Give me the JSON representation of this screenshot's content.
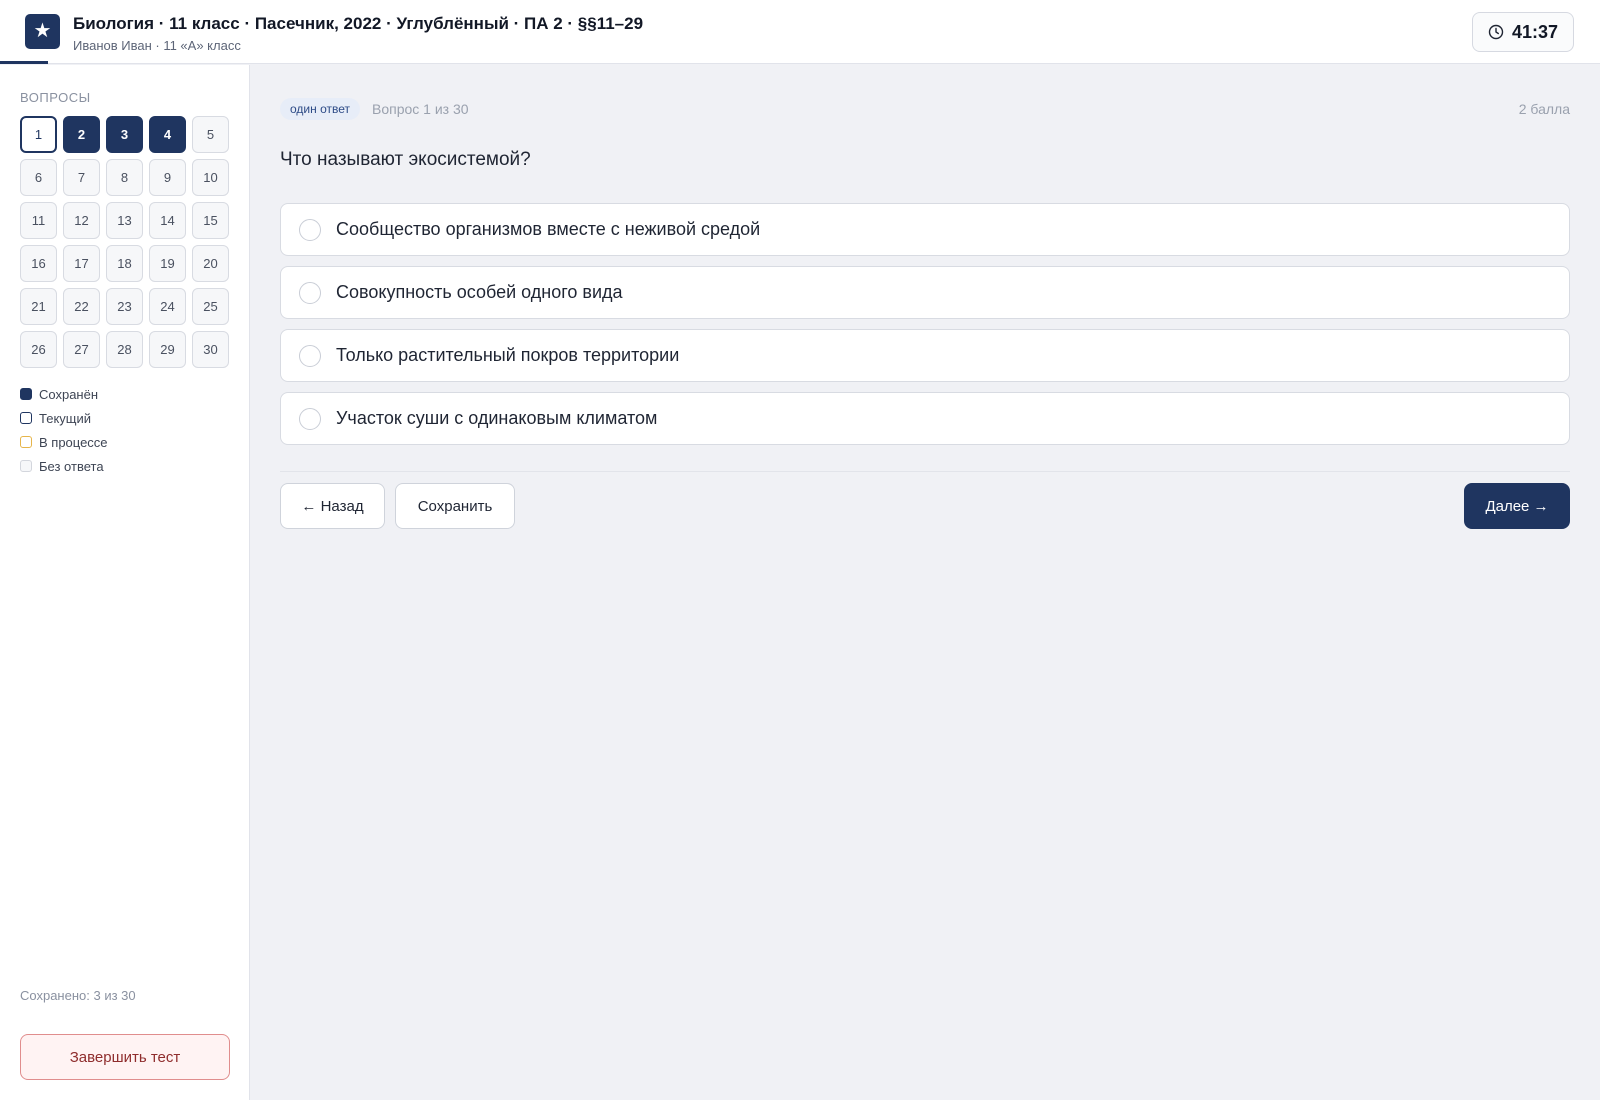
{
  "header": {
    "logo_glyph": "★",
    "title": "Биология · 11 класс · Пасечник, 2022 · Углублённый · ПА 2 · §§11–29",
    "subtitle": "Иванов Иван · 11 «А» класс",
    "timer": "41:37",
    "timer_icon": "clock-icon"
  },
  "sidebar": {
    "title": "ВОПРОСЫ",
    "questions": [
      {
        "n": "1",
        "state": "current"
      },
      {
        "n": "2",
        "state": "saved"
      },
      {
        "n": "3",
        "state": "saved"
      },
      {
        "n": "4",
        "state": "saved"
      },
      {
        "n": "5",
        "state": "empty"
      },
      {
        "n": "6",
        "state": "empty"
      },
      {
        "n": "7",
        "state": "empty"
      },
      {
        "n": "8",
        "state": "empty"
      },
      {
        "n": "9",
        "state": "empty"
      },
      {
        "n": "10",
        "state": "empty"
      },
      {
        "n": "11",
        "state": "empty"
      },
      {
        "n": "12",
        "state": "empty"
      },
      {
        "n": "13",
        "state": "empty"
      },
      {
        "n": "14",
        "state": "empty"
      },
      {
        "n": "15",
        "state": "empty"
      },
      {
        "n": "16",
        "state": "empty"
      },
      {
        "n": "17",
        "state": "empty"
      },
      {
        "n": "18",
        "state": "empty"
      },
      {
        "n": "19",
        "state": "empty"
      },
      {
        "n": "20",
        "state": "empty"
      },
      {
        "n": "21",
        "state": "empty"
      },
      {
        "n": "22",
        "state": "empty"
      },
      {
        "n": "23",
        "state": "empty"
      },
      {
        "n": "24",
        "state": "empty"
      },
      {
        "n": "25",
        "state": "empty"
      },
      {
        "n": "26",
        "state": "empty"
      },
      {
        "n": "27",
        "state": "empty"
      },
      {
        "n": "28",
        "state": "empty"
      },
      {
        "n": "29",
        "state": "empty"
      },
      {
        "n": "30",
        "state": "empty"
      }
    ],
    "legend": [
      {
        "key": "saved",
        "label": "Сохранён"
      },
      {
        "key": "current",
        "label": "Текущий"
      },
      {
        "key": "progress",
        "label": "В процессе"
      },
      {
        "key": "empty",
        "label": "Без ответа"
      }
    ],
    "saved_count": "Сохранено: 3 из 30",
    "finish_label": "Завершить тест"
  },
  "main": {
    "badge": "один ответ",
    "question_number": "Вопрос 1 из 30",
    "points": "2 балла",
    "question": "Что называют экосистемой?",
    "options": [
      "Сообщество организмов вместе с неживой средой",
      "Совокупность особей одного вида",
      "Только растительный покров территории",
      "Участок суши с одинаковым климатом"
    ],
    "back_label": "← Назад",
    "save_label": "Сохранить",
    "next_label": "Далее →"
  },
  "colors": {
    "accent": "#1f3560",
    "progress": "#e6b54a",
    "danger": "#8f2d2d"
  }
}
